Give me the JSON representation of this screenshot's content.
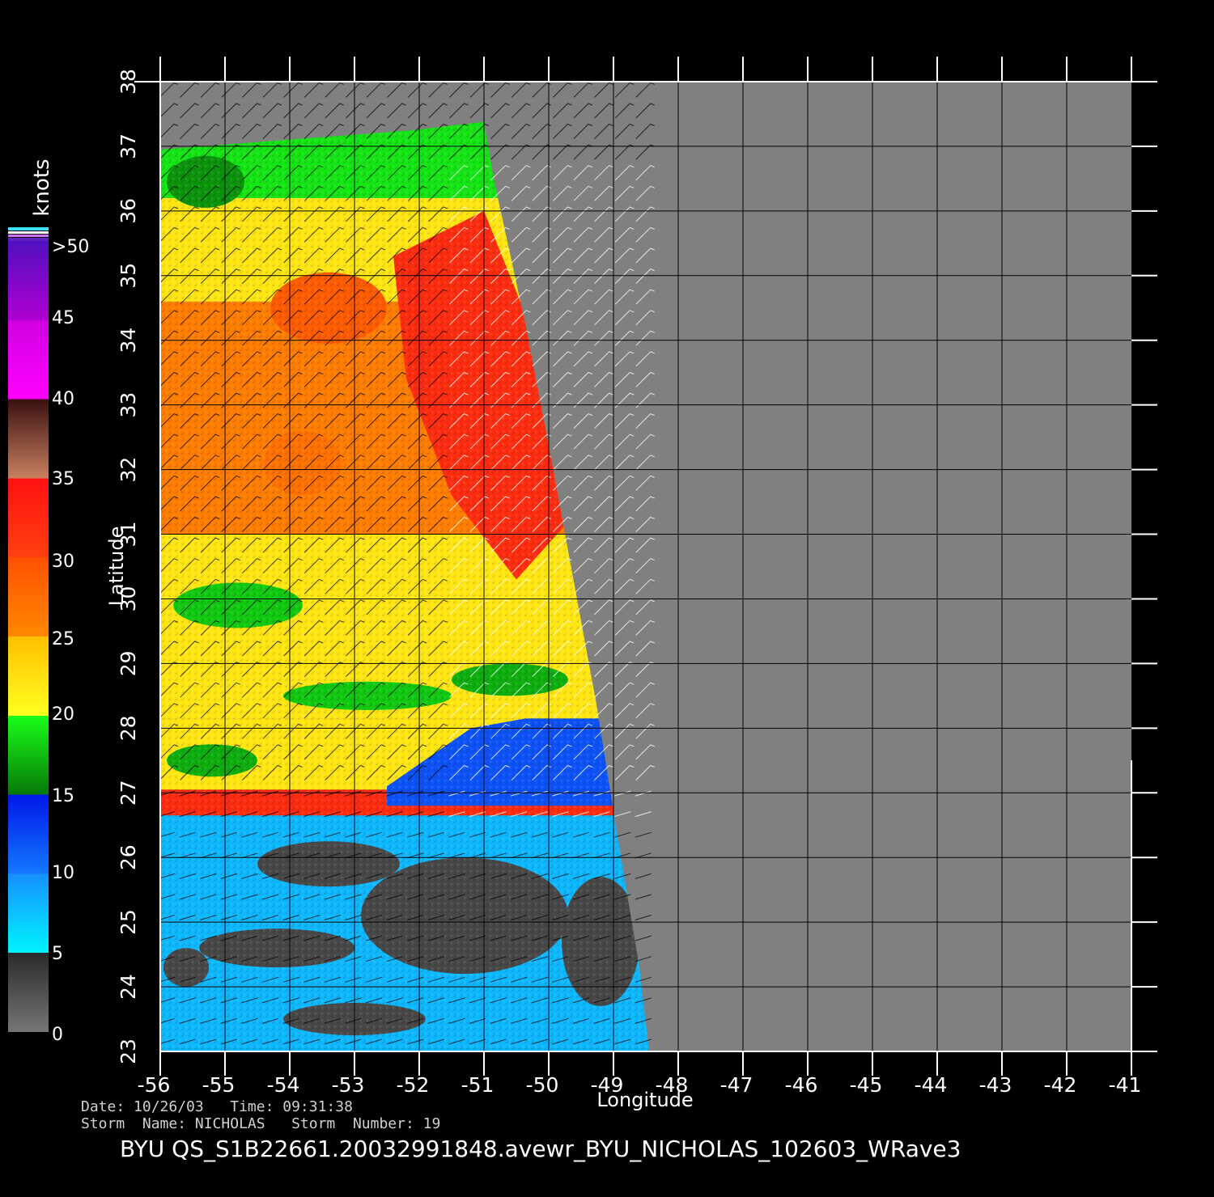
{
  "chart_data": {
    "type": "heatmap",
    "xlabel": "Longitude",
    "ylabel": "Latitude",
    "xlim": [
      -56,
      -41
    ],
    "ylim": [
      23,
      38
    ],
    "x_ticks": [
      "-56",
      "-55",
      "-54",
      "-53",
      "-52",
      "-51",
      "-50",
      "-49",
      "-48",
      "-47",
      "-46",
      "-45",
      "-44",
      "-43",
      "-42",
      "-41"
    ],
    "y_ticks": [
      "23",
      "24",
      "25",
      "26",
      "27",
      "28",
      "29",
      "30",
      "31",
      "32",
      "33",
      "34",
      "35",
      "36",
      "37",
      "38"
    ],
    "grid": true,
    "colorbar": {
      "label": "knots",
      "tick_labels": [
        "0",
        "5",
        "10",
        "15",
        "20",
        "25",
        "30",
        "35",
        "40",
        "45",
        ">50"
      ],
      "tick_values": [
        0,
        5,
        10,
        15,
        20,
        25,
        30,
        35,
        40,
        45,
        50
      ],
      "bands": [
        {
          "from": 0,
          "to": 5,
          "colors": [
            "#767676",
            "#2a2a2a"
          ]
        },
        {
          "from": 5,
          "to": 10,
          "colors": [
            "#00f4ff",
            "#1690ff"
          ]
        },
        {
          "from": 10,
          "to": 15,
          "colors": [
            "#1478ff",
            "#0018e8"
          ]
        },
        {
          "from": 15,
          "to": 20,
          "colors": [
            "#087808",
            "#18ff18"
          ]
        },
        {
          "from": 20,
          "to": 25,
          "colors": [
            "#ffff20",
            "#ffc000"
          ]
        },
        {
          "from": 25,
          "to": 30,
          "colors": [
            "#ff8800",
            "#ff5000"
          ]
        },
        {
          "from": 30,
          "to": 35,
          "colors": [
            "#ff4010",
            "#ff1010"
          ]
        },
        {
          "from": 35,
          "to": 40,
          "colors": [
            "#c88060",
            "#3a1010"
          ]
        },
        {
          "from": 40,
          "to": 45,
          "colors": [
            "#ff00ff",
            "#d000e0"
          ]
        },
        {
          "from": 45,
          "to": 50,
          "colors": [
            "#b000d0",
            "#5010c0"
          ]
        }
      ]
    },
    "swath_boundary": [
      [
        -56,
        36.95
      ],
      [
        -52.1,
        37.25
      ],
      [
        -51.0,
        37.38
      ],
      [
        -50.85,
        36.5
      ],
      [
        -50.35,
        34.2
      ],
      [
        -49.95,
        32.1
      ],
      [
        -49.6,
        30.2
      ],
      [
        -49.25,
        28.3
      ],
      [
        -48.95,
        26.4
      ],
      [
        -48.6,
        24.3
      ],
      [
        -48.45,
        23.0
      ],
      [
        -56,
        23.0
      ]
    ],
    "regions": [
      {
        "kind": "rect",
        "x0": -56,
        "x1": -49.0,
        "y0": 26.65,
        "y1": 27.05,
        "knots": 32
      },
      {
        "kind": "rect",
        "x0": -56,
        "x1": -48.3,
        "y0": 23.0,
        "y1": 26.65,
        "knots": 8
      },
      {
        "kind": "rect",
        "x0": -56,
        "x1": -49.0,
        "y0": 27.05,
        "y1": 28.15,
        "knots": 22
      },
      {
        "kind": "poly",
        "points": [
          [
            -52.5,
            27.1
          ],
          [
            -51.2,
            28.0
          ],
          [
            -49.8,
            28.25
          ],
          [
            -49.1,
            28.45
          ],
          [
            -49.0,
            26.8
          ],
          [
            -52.5,
            26.8
          ]
        ],
        "knots": 12
      },
      {
        "kind": "rect",
        "x0": -56,
        "x1": -49.0,
        "y0": 28.15,
        "y1": 31.0,
        "knots": 22
      },
      {
        "kind": "rect",
        "x0": -56,
        "x1": -49.5,
        "y0": 31.0,
        "y1": 34.6,
        "knots": 26
      },
      {
        "kind": "rect",
        "x0": -56,
        "x1": -49.5,
        "y0": 34.6,
        "y1": 36.2,
        "knots": 22
      },
      {
        "kind": "rect",
        "x0": -56,
        "x1": -49.5,
        "y0": 36.2,
        "y1": 37.4,
        "knots": 19
      },
      {
        "kind": "poly",
        "points": [
          [
            -52.4,
            35.3
          ],
          [
            -51.0,
            36.0
          ],
          [
            -50.2,
            34.0
          ],
          [
            -49.6,
            31.3
          ],
          [
            -50.5,
            30.3
          ],
          [
            -51.5,
            31.6
          ],
          [
            -52.2,
            33.4
          ]
        ],
        "knots": 32
      },
      {
        "kind": "ellipse",
        "lon": -53.4,
        "lat": 34.5,
        "rlon": 0.9,
        "rlat": 0.55,
        "knots": 29
      },
      {
        "kind": "ellipse",
        "lon": -53.8,
        "lat": 32.1,
        "rlon": 0.6,
        "rlat": 0.5,
        "knots": 27
      },
      {
        "kind": "ellipse",
        "lon": -55.3,
        "lat": 36.45,
        "rlon": 0.6,
        "rlat": 0.4,
        "knots": 16
      },
      {
        "kind": "ellipse",
        "lon": -52.8,
        "lat": 28.5,
        "rlon": 1.3,
        "rlat": 0.22,
        "knots": 18
      },
      {
        "kind": "ellipse",
        "lon": -54.8,
        "lat": 29.9,
        "rlon": 1.0,
        "rlat": 0.35,
        "knots": 18
      },
      {
        "kind": "ellipse",
        "lon": -55.2,
        "lat": 27.5,
        "rlon": 0.7,
        "rlat": 0.25,
        "knots": 17
      },
      {
        "kind": "ellipse",
        "lon": -50.6,
        "lat": 28.75,
        "rlon": 0.9,
        "rlat": 0.25,
        "knots": 17
      },
      {
        "kind": "ellipse",
        "lon": -51.3,
        "lat": 25.1,
        "rlon": 1.6,
        "rlat": 0.9,
        "knots": 3
      },
      {
        "kind": "ellipse",
        "lon": -49.2,
        "lat": 24.7,
        "rlon": 0.6,
        "rlat": 1.0,
        "knots": 3
      },
      {
        "kind": "ellipse",
        "lon": -53.4,
        "lat": 25.9,
        "rlon": 1.1,
        "rlat": 0.35,
        "knots": 3
      },
      {
        "kind": "ellipse",
        "lon": -54.2,
        "lat": 24.6,
        "rlon": 1.2,
        "rlat": 0.3,
        "knots": 3
      },
      {
        "kind": "ellipse",
        "lon": -53.0,
        "lat": 23.5,
        "rlon": 1.1,
        "rlat": 0.25,
        "knots": 3
      },
      {
        "kind": "ellipse",
        "lon": -55.6,
        "lat": 24.3,
        "rlon": 0.35,
        "rlat": 0.3,
        "knots": 3
      }
    ]
  },
  "info": {
    "date_line": "Date: 10/26/03   Time: 09:31:38",
    "storm_line": "Storm  Name: NICHOLAS   Storm  Number: 19"
  },
  "product_title": "BYU  QS_S1B22661.20032991848.avewr_BYU_NICHOLAS_102603_WRave3",
  "colors": {
    "background": "#000000",
    "no_data": "#808080",
    "grid": "#000000",
    "axis": "#ffffff"
  }
}
